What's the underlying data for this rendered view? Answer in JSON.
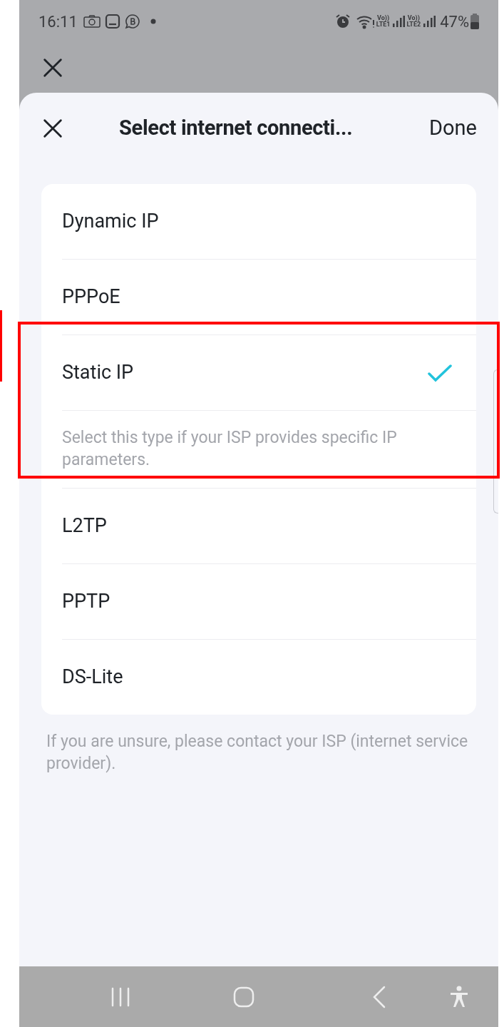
{
  "status_bar": {
    "time": "16:11",
    "sims": [
      {
        "top": "Vo))",
        "bottom": "LTE1"
      },
      {
        "top": "Vo))",
        "bottom": "LTE2"
      }
    ],
    "battery": "47%"
  },
  "sheet": {
    "title": "Select internet connecti...",
    "done": "Done",
    "options": [
      {
        "label": "Dynamic IP",
        "selected": false
      },
      {
        "label": "PPPoE",
        "selected": false
      },
      {
        "label": "Static IP",
        "selected": true,
        "description": "Select this type if your ISP provides specific IP parameters."
      },
      {
        "label": "L2TP",
        "selected": false
      },
      {
        "label": "PPTP",
        "selected": false
      },
      {
        "label": "DS-Lite",
        "selected": false
      }
    ],
    "note": "If you are unsure, please contact your ISP (internet service provider)."
  }
}
